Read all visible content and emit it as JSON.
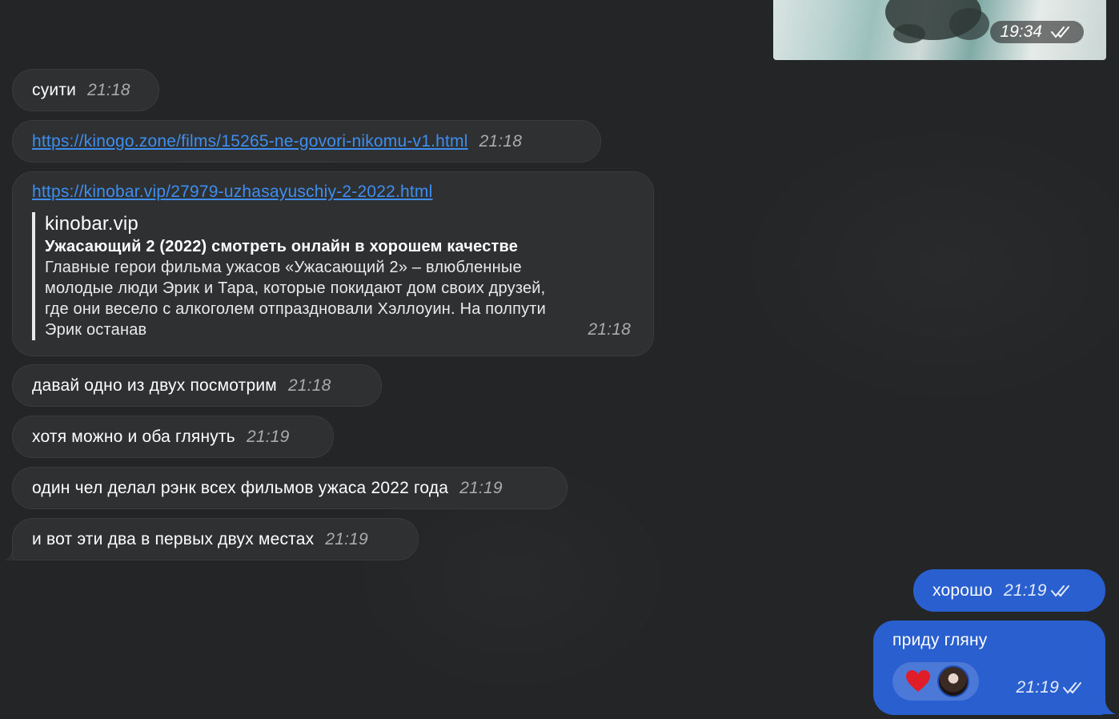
{
  "photo": {
    "time": "19:34"
  },
  "messages": [
    {
      "text": "суити",
      "time": "21:18"
    },
    {
      "link": "https://kinogo.zone/films/15265-ne-govori-nikomu-v1.html",
      "time": "21:18"
    },
    {
      "link": "https://kinobar.vip/27979-uzhasayuschiy-2-2022.html",
      "preview": {
        "site": "kinobar.vip",
        "title": "Ужасающий 2 (2022) смотреть онлайн в хорошем качестве",
        "desc_lines": [
          "Главные герои фильма ужасов «Ужасающий 2» – влюбленные",
          "молодые люди Эрик и Тара, которые покидают дом своих друзей,",
          "где они весело с алкоголем отпраздновали Хэллоуин. На полпути",
          "Эрик останав"
        ]
      },
      "time": "21:18"
    },
    {
      "text": "давай одно из двух посмотрим",
      "time": "21:18"
    },
    {
      "text": "хотя можно и оба глянуть",
      "time": "21:19"
    },
    {
      "text": "один чел делал рэнк всех фильмов ужаса 2022 года",
      "time": "21:19"
    },
    {
      "text": "и вот эти два в первых двух местах",
      "time": "21:19"
    }
  ],
  "outgoing": [
    {
      "text": "хорошо",
      "time": "21:19"
    },
    {
      "text": "приду гляну",
      "time": "21:19",
      "reaction": "heart-emoji"
    }
  ]
}
